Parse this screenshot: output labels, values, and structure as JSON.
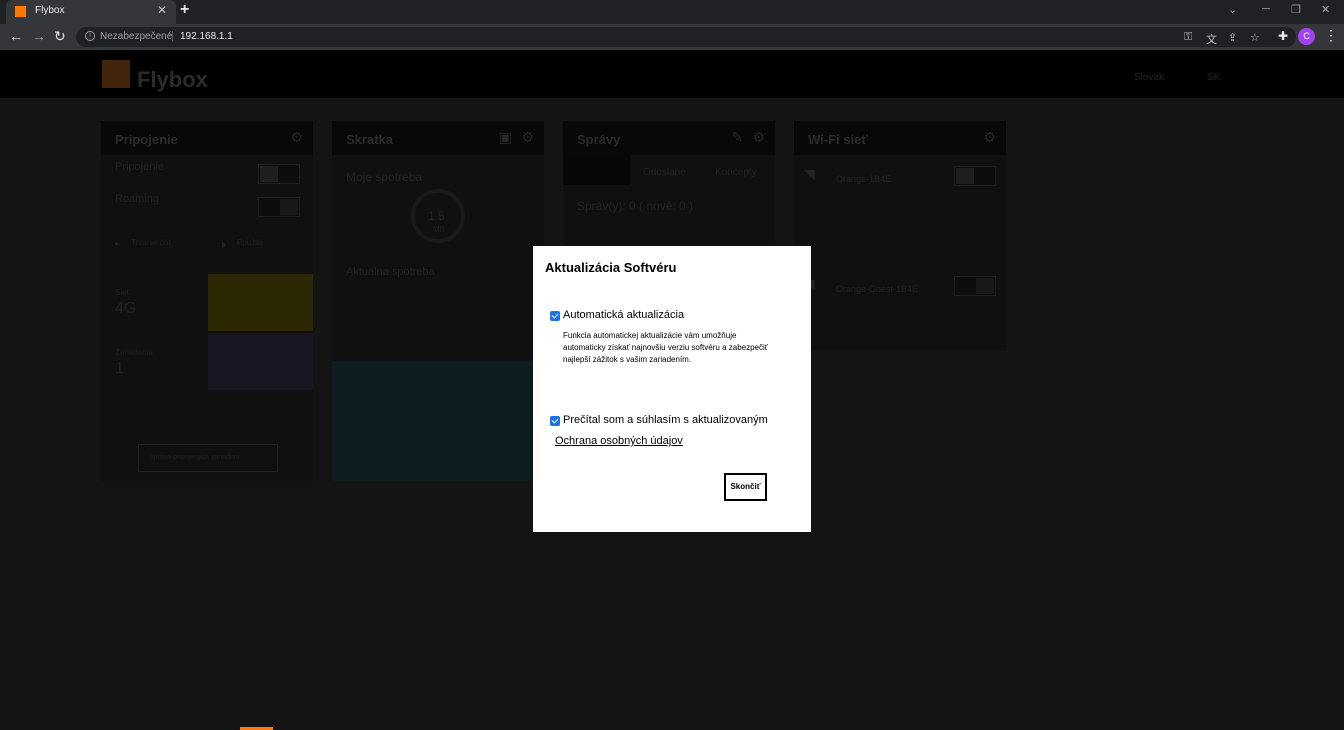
{
  "browser": {
    "tab_title": "Flybox",
    "tab_close": "✕",
    "new_tab": "+",
    "security_label": "Nezabezpečené",
    "url": "192.168.1.1",
    "profile_initial": "C"
  },
  "page": {
    "logo_text": "Flybox",
    "header_items": [
      "Slovak",
      "SK"
    ],
    "cards": [
      {
        "title": "Pripojenie"
      },
      {
        "title": "Skratka"
      },
      {
        "title": "Správy"
      },
      {
        "title": "Wi-Fi sieť"
      }
    ],
    "connection": {
      "row1": "Pripojenie",
      "row2": "Roaming",
      "stat1": "Trvanie dát",
      "stat2": "Použité",
      "net_label": "Sieť",
      "net_value": "4G",
      "devices_label": "Zariadenia",
      "devices_value": "1",
      "button": "Správa pripojených zariadení"
    },
    "shortcut": {
      "subtitle": "Moje spotreba",
      "ring_value": "1.5",
      "ring_unit": "MB",
      "usage": "Aktuálna spotreba"
    },
    "messages": {
      "tab2": "Odoslané",
      "tab3": "Koncepty",
      "summary": "Správ(y): 0 ( nové: 0 )"
    },
    "wifi": {
      "ssid1": "Orange-1B4E",
      "ssid2": "Orange-Guest-1B4E"
    }
  },
  "modal": {
    "title": "Aktualizácia Softvéru",
    "auto_update_label": "Automatická aktualizácia",
    "auto_update_checked": true,
    "auto_update_desc": "Funkcia automatickej aktualizácie vám umožňuje automaticky získať najnovšiu verziu softvéru a zabezpečiť najlepší zážitok s vašim zariadením.",
    "consent_label": "Prečítal som a súhlasím s aktualizovaným",
    "consent_checked": true,
    "privacy_link": "Ochrana osobných údajov",
    "finish_button": "Skončiť"
  },
  "colors": {
    "brand": "#ff7900",
    "checkbox": "#1a73e8"
  }
}
